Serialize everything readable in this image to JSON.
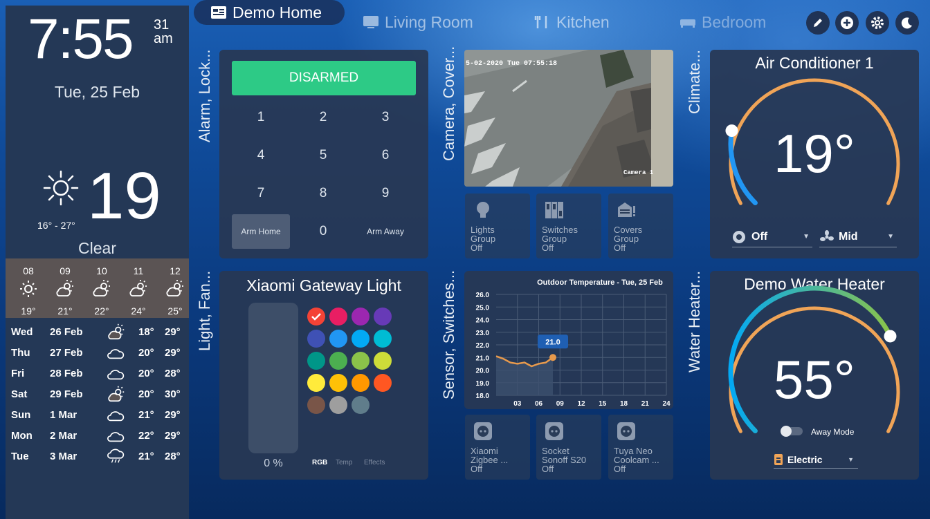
{
  "clock": {
    "time": "7:55",
    "seconds": "31",
    "ampm": "am",
    "date": "Tue, 25 Feb"
  },
  "weather": {
    "temp": "19",
    "range": "16° - 27°",
    "condition": "Clear",
    "hourly": [
      {
        "h": "08",
        "t": "19°",
        "icon": "sun-icon"
      },
      {
        "h": "09",
        "t": "21°",
        "icon": "partly-cloudy-icon"
      },
      {
        "h": "10",
        "t": "22°",
        "icon": "partly-cloudy-icon"
      },
      {
        "h": "11",
        "t": "24°",
        "icon": "partly-cloudy-icon"
      },
      {
        "h": "12",
        "t": "25°",
        "icon": "partly-cloudy-icon"
      }
    ],
    "daily": [
      {
        "d": "Wed",
        "date": "26 Feb",
        "lo": "18°",
        "hi": "29°",
        "icon": "partly-cloudy-icon"
      },
      {
        "d": "Thu",
        "date": "27 Feb",
        "lo": "20°",
        "hi": "29°",
        "icon": "cloud-icon"
      },
      {
        "d": "Fri",
        "date": "28 Feb",
        "lo": "20°",
        "hi": "28°",
        "icon": "cloud-icon"
      },
      {
        "d": "Sat",
        "date": "29 Feb",
        "lo": "20°",
        "hi": "30°",
        "icon": "partly-cloudy-icon"
      },
      {
        "d": "Sun",
        "date": "1 Mar",
        "lo": "21°",
        "hi": "29°",
        "icon": "cloud-icon"
      },
      {
        "d": "Mon",
        "date": "2 Mar",
        "lo": "22°",
        "hi": "29°",
        "icon": "cloud-icon"
      },
      {
        "d": "Tue",
        "date": "3 Mar",
        "lo": "21°",
        "hi": "28°",
        "icon": "rain-icon"
      }
    ]
  },
  "tabs": [
    "Demo Home",
    "Living Room",
    "Kitchen",
    "Bedroom"
  ],
  "sections": {
    "alarm": "Alarm, Lock...",
    "camera": "Camera, Cover...",
    "climate": "Climate...",
    "light": "Light, Fan...",
    "sensor": "Sensor, Switches...",
    "water": "Water Heater..."
  },
  "alarm": {
    "state": "DISARMED",
    "keys": [
      "1",
      "2",
      "3",
      "4",
      "5",
      "6",
      "7",
      "8",
      "9",
      "Arm Home",
      "0",
      "Arm Away"
    ]
  },
  "camera": {
    "timestamp": "5-02-2020 Tue 07:55:18",
    "name": "Camera 1"
  },
  "groups": [
    {
      "l1": "Lights",
      "l2": "Group",
      "s": "Off"
    },
    {
      "l1": "Switches",
      "l2": "Group",
      "s": "Off"
    },
    {
      "l1": "Covers",
      "l2": "Group",
      "s": "Off"
    }
  ],
  "ac": {
    "title": "Air Conditioner 1",
    "temp": "19°",
    "mode": "Off",
    "fan": "Mid",
    "level": 0.2
  },
  "light": {
    "title": "Xiaomi Gateway Light",
    "brightness": "0 %",
    "tabs": [
      "RGB",
      "Temp",
      "Effects"
    ],
    "colors": [
      "#f44336",
      "#e91e63",
      "#9c27b0",
      "#673ab7",
      "#3f51b5",
      "#2196f3",
      "#03a9f4",
      "#00bcd4",
      "#009688",
      "#4caf50",
      "#8bc34a",
      "#cddc39",
      "#ffeb3b",
      "#ffc107",
      "#ff9800",
      "#ff5722",
      "#795548",
      "#9e9e9e",
      "#607d8b"
    ]
  },
  "chart_data": {
    "type": "line",
    "title": "Outdoor Temperature - Tue, 25 Feb",
    "x": [
      0,
      1,
      2,
      3,
      4,
      5,
      6,
      7,
      8
    ],
    "y": [
      21.1,
      20.9,
      20.6,
      20.5,
      20.6,
      20.3,
      20.5,
      20.6,
      21.0
    ],
    "callout": "21.0",
    "xticks": [
      "03",
      "06",
      "09",
      "12",
      "15",
      "18",
      "21",
      "24"
    ],
    "yticks": [
      "26.0",
      "25.0",
      "24.0",
      "23.0",
      "22.0",
      "21.0",
      "20.0",
      "19.0",
      "18.0"
    ],
    "xlim": [
      0,
      24
    ],
    "ylim": [
      18,
      26
    ]
  },
  "sockets": [
    {
      "l1": "Xiaomi",
      "l2": "Zigbee ...",
      "s": "Off"
    },
    {
      "l1": "Socket",
      "l2": "Sonoff S20",
      "s": "Off"
    },
    {
      "l1": "Tuya Neo",
      "l2": "Coolcam ...",
      "s": "Off"
    }
  ],
  "water": {
    "title": "Demo Water Heater",
    "temp": "55°",
    "away": "Away Mode",
    "op": "Electric",
    "level": 0.74
  }
}
